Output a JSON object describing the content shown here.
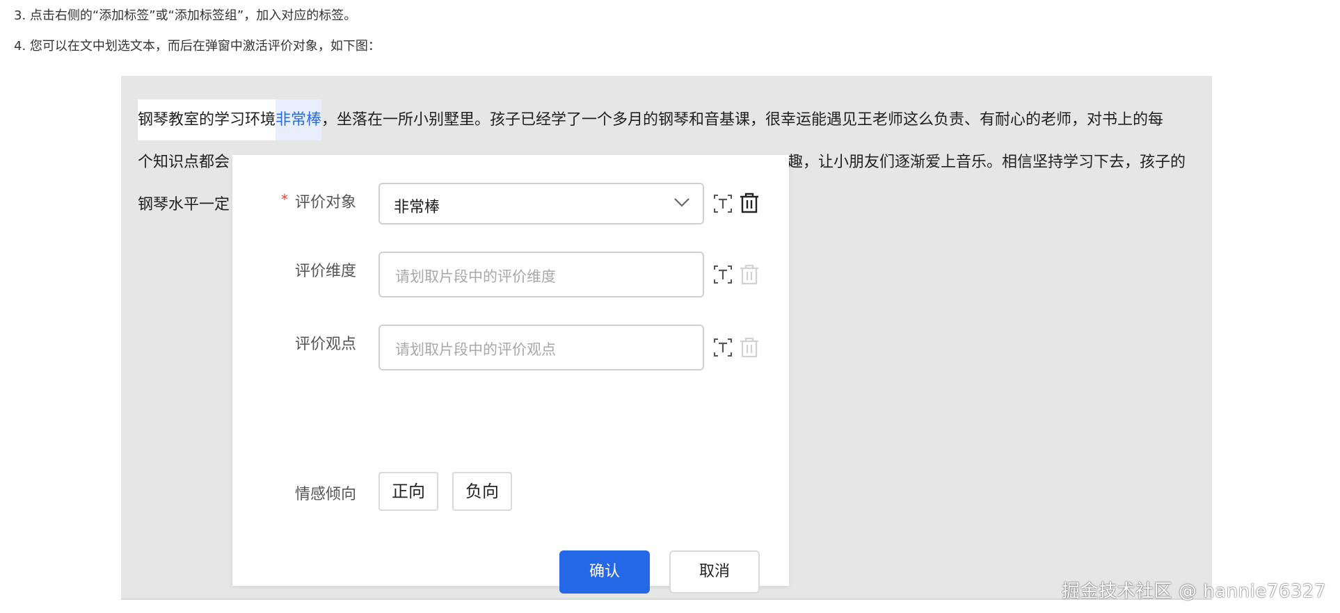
{
  "instructions": {
    "step3": "3. 点击右侧的“添加标签”或“添加标签组”，加入对应的标签。",
    "step4": "4. 您可以在文中划选文本，而后在弹窗中激活评价对象，如下图："
  },
  "document": {
    "line1_prefix": "钢琴教室的学习环境",
    "line1_highlight": "非常棒",
    "line1_suffix": "，坐落在一所小别墅里。孩子已经学了一个多月的钢琴和音基课，很幸运能遇见王老师这么负责、有耐心的老师，对书上的每",
    "line2_left": "个知识点都会",
    "line2_right": "趣，让小朋友们逐渐爱上音乐。相信坚持学习下去，孩子的",
    "line3_left": "钢琴水平一定"
  },
  "dialog": {
    "required_mark": "*",
    "target": {
      "label": "评价对象",
      "value": "非常棒"
    },
    "dimension": {
      "label": "评价维度",
      "placeholder": "请划取片段中的评价维度"
    },
    "opinion": {
      "label": "评价观点",
      "placeholder": "请划取片段中的评价观点"
    },
    "sentiment": {
      "label": "情感倾向",
      "options": [
        "正向",
        "负向"
      ]
    },
    "buttons": {
      "confirm": "确认",
      "cancel": "取消"
    }
  },
  "icons": {
    "select_text": "text-select-icon",
    "delete": "trash-icon",
    "dropdown": "chevron-down-icon"
  },
  "colors": {
    "primary": "#2468e8",
    "required": "#e5483d",
    "highlight_text": "#2b6cd8"
  },
  "watermark": "掘金技术社区 @ hannie76327"
}
